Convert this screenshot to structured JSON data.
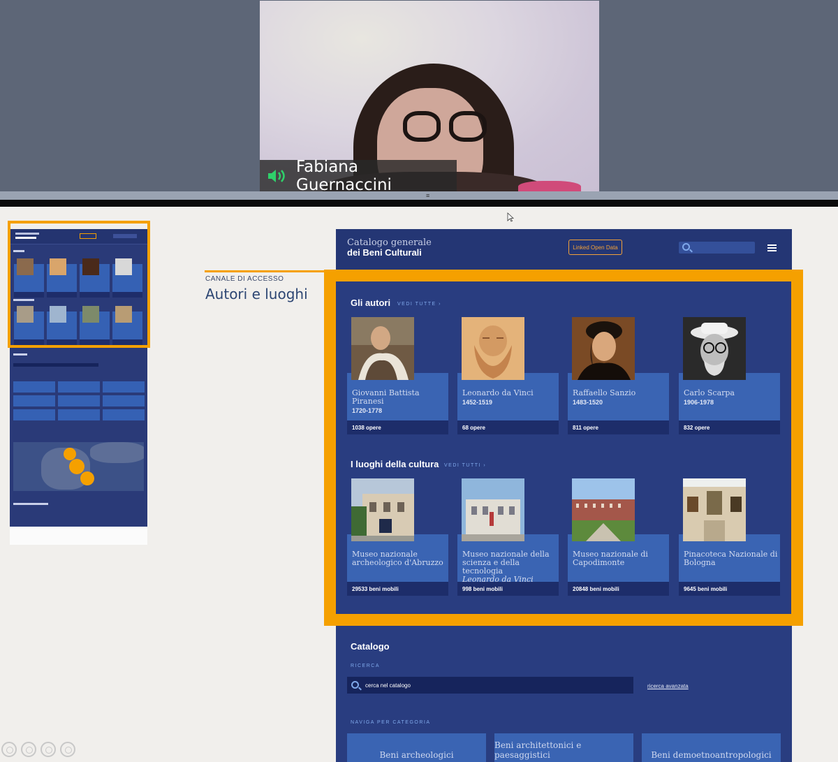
{
  "video": {
    "participant_name": "Fabiana Guernaccini",
    "audio_icon": "speaker-icon"
  },
  "slide": {
    "kicker": "CANALE DI ACCESSO",
    "title": "Autori e luoghi"
  },
  "mock": {
    "brand_line1": "Catalogo generale",
    "brand_line2": "dei Beni Culturali",
    "lod_button": "Linked Open Data",
    "authors_title": "Gli autori",
    "authors_see_all": "VEDI TUTTE ›",
    "authors": [
      {
        "name": "Giovanni Battista Piranesi",
        "years": "1720-1778",
        "works": "1038 opere"
      },
      {
        "name": "Leonardo da Vinci",
        "years": "1452-1519",
        "works": "68 opere"
      },
      {
        "name": "Raffaello Sanzio",
        "years": "1483-1520",
        "works": "811 opere"
      },
      {
        "name": "Carlo Scarpa",
        "years": "1906-1978",
        "works": "832 opere"
      }
    ],
    "places_title": "I luoghi della cultura",
    "places_see_all": "VEDI TUTTI ›",
    "places": [
      {
        "name": "Museo nazionale archeologico d'Abruzzo",
        "extra": "",
        "count": "29533 beni mobili"
      },
      {
        "name": "Museo nazionale della scienza e della tecnologia",
        "extra": "Leonardo da Vinci",
        "count": "998 beni mobili"
      },
      {
        "name": "Museo nazionale di Capodimonte",
        "extra": "",
        "count": "20848 beni mobili"
      },
      {
        "name": "Pinacoteca Nazionale di Bologna",
        "extra": "",
        "count": "9645 beni mobili"
      }
    ],
    "catalog": {
      "title": "Catalogo",
      "search_label": "RICERCA",
      "search_placeholder": "cerca nel catalogo",
      "advanced_link": "ricerca avanzata",
      "category_label": "NAVIGA PER CATEGORIA",
      "categories": [
        "Beni archeologici",
        "Beni architettonici e paesaggistici",
        "Beni demoetnoantropologici"
      ]
    }
  },
  "colors": {
    "accent": "#f5a000",
    "mock_background": "#293d80",
    "card": "#3a64b3",
    "card_footer": "#1d2d6a"
  }
}
